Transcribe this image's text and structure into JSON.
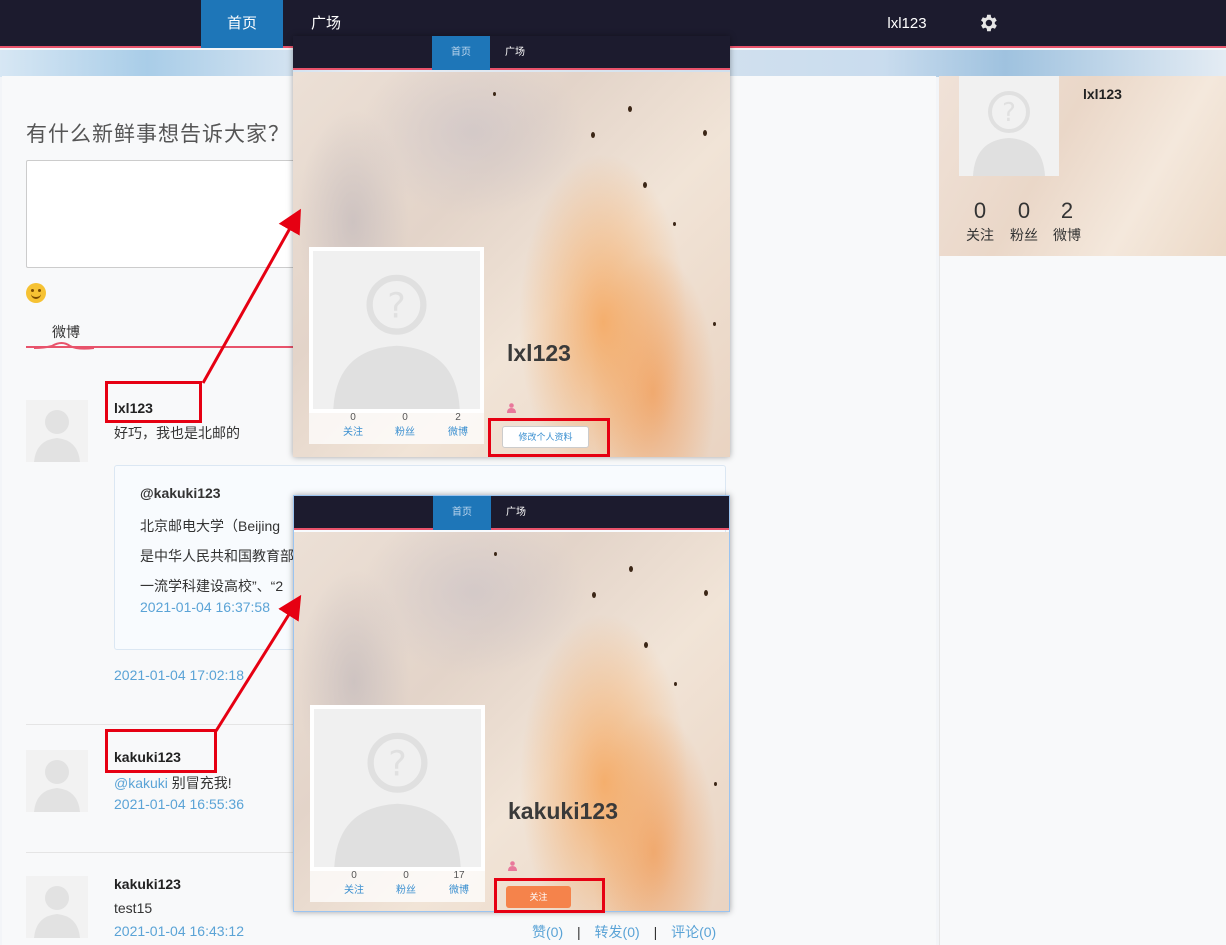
{
  "nav": {
    "home": "首页",
    "square": "广场",
    "username": "lxl123",
    "settings_icon": "gear-icon"
  },
  "composer": {
    "title": "有什么新鲜事想告诉大家？",
    "emoji_icon": "smile-emoji-icon"
  },
  "feed": {
    "tab": "微博",
    "posts": [
      {
        "user": "lxl123",
        "text": "好巧，我也是北邮的",
        "quote": {
          "user": "@kakuki123",
          "lines": [
            "北京邮电大学（Beijing",
            "是中华人民共和国教育部",
            "一流学科建设高校”、“2"
          ],
          "time": "2021-01-04 16:37:58"
        },
        "time": "2021-01-04 17:02:18"
      },
      {
        "user": "kakuki123",
        "mention": "@kakuki",
        "text": " 别冒充我!",
        "time": "2021-01-04 16:55:36"
      },
      {
        "user": "kakuki123",
        "text": "test15",
        "time": "2021-01-04 16:43:12",
        "actions": {
          "like": "赞(0)",
          "repost": "转发(0)",
          "comment": "评论(0)",
          "sep": "|"
        }
      }
    ]
  },
  "sidebar": {
    "username": "lxl123",
    "stats": [
      {
        "num": "0",
        "label": "关注"
      },
      {
        "num": "0",
        "label": "粉丝"
      },
      {
        "num": "2",
        "label": "微博"
      }
    ]
  },
  "popup_self": {
    "nav_home": "首页",
    "nav_square": "广场",
    "username": "lxl123",
    "stats": [
      {
        "num": "0",
        "label": "关注"
      },
      {
        "num": "0",
        "label": "粉丝"
      },
      {
        "num": "2",
        "label": "微博"
      }
    ],
    "button": "修改个人资料"
  },
  "popup_other": {
    "nav_home": "首页",
    "nav_square": "广场",
    "username": "kakuki123",
    "stats": [
      {
        "num": "0",
        "label": "关注"
      },
      {
        "num": "0",
        "label": "粉丝"
      },
      {
        "num": "17",
        "label": "微博"
      }
    ],
    "button": "关注"
  },
  "colors": {
    "nav_bg": "#1c1b2e",
    "nav_active": "#1e76b8",
    "accent_pink": "#e8536b",
    "link_blue": "#5aa3d6",
    "annotation_red": "#e60012",
    "follow_orange": "#f5834b"
  }
}
